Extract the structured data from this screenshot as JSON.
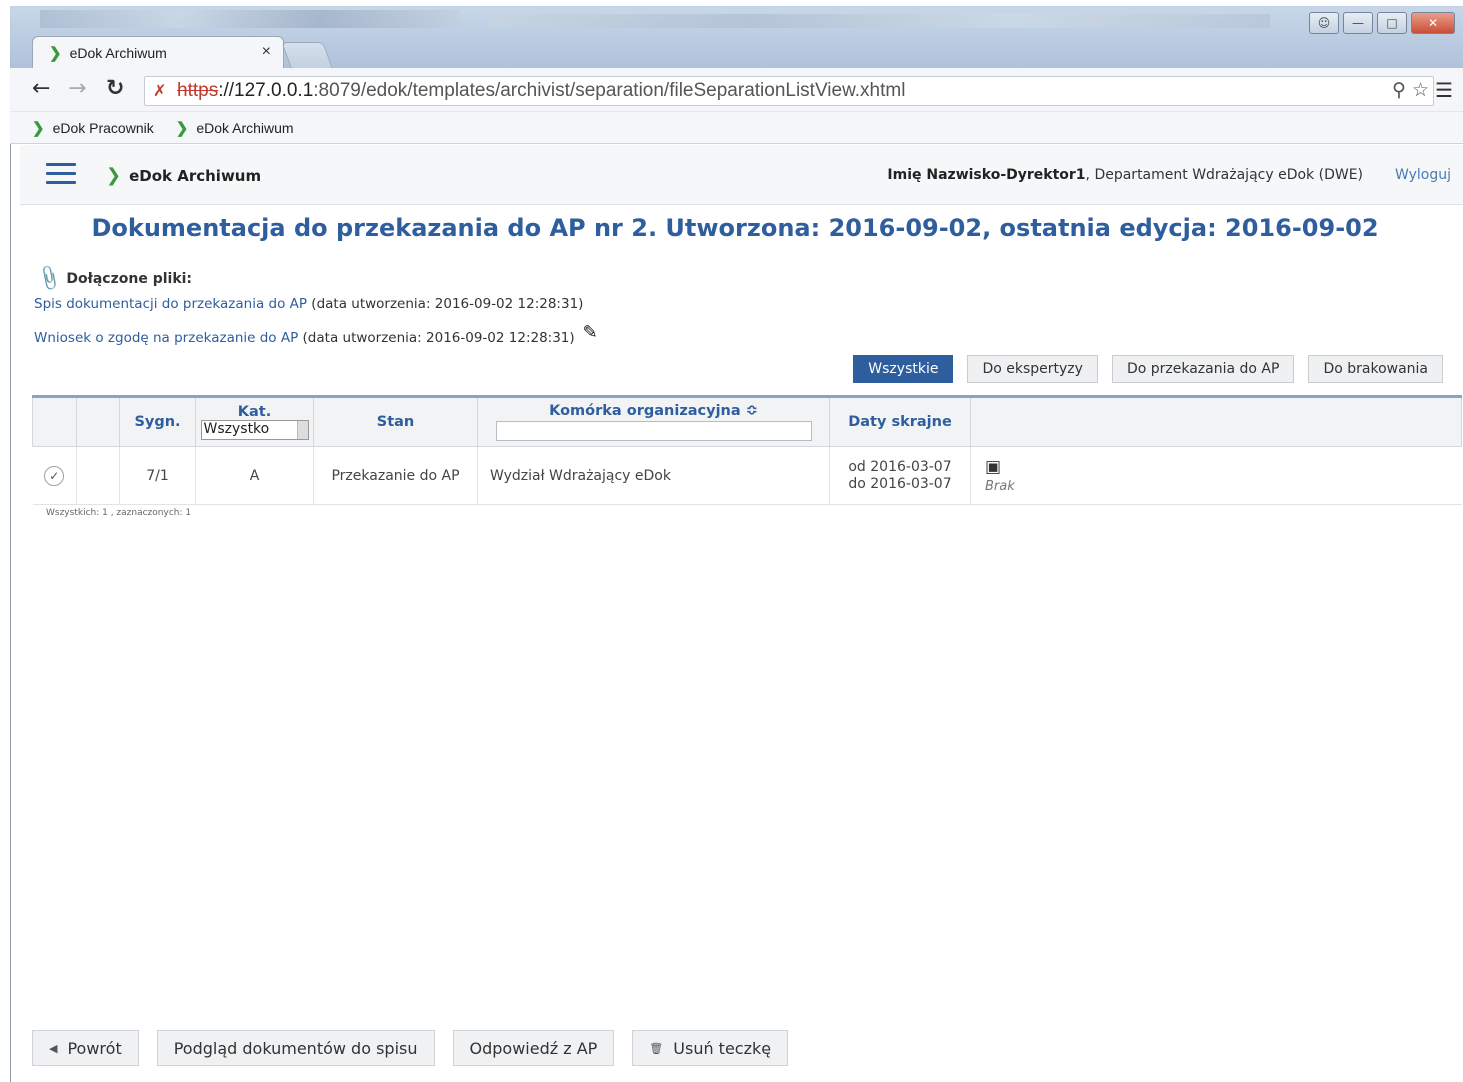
{
  "browser": {
    "tab_title": "eDok Archiwum",
    "tab_close": "×",
    "url_scheme": "https",
    "url_host": "://127.0.0.1",
    "url_rest": ":8079/edok/templates/archivist/separation/fileSeparationListView.xhtml",
    "bookmarks": [
      "eDok Pracownik",
      "eDok Archiwum"
    ],
    "icons": [
      "back-icon",
      "forward-icon",
      "reload-icon",
      "insecure-icon",
      "zoom-icon",
      "star-icon",
      "menu-icon"
    ]
  },
  "app": {
    "name": "eDok Archiwum",
    "user_name": "Imię Nazwisko-Dyrektor1",
    "user_dept": ", Departament Wdrażający eDok (DWE)",
    "logout": "Wyloguj"
  },
  "page": {
    "title": "Dokumentacja do przekazania do AP nr 2. Utworzona: 2016-09-02, ostatnia edycja: 2016-09-02",
    "attached_label": "Dołączone pliki:",
    "files": [
      {
        "link": "Spis dokumentacji do przekazania do AP",
        "meta": " (data utworzenia: 2016-09-02 12:28:31)"
      },
      {
        "link": "Wniosek o zgodę na przekazanie do AP",
        "meta": " (data utworzenia: 2016-09-02 12:28:31)"
      }
    ]
  },
  "filters": [
    "Wszystkie",
    "Do ekspertyzy",
    "Do przekazania do AP",
    "Do brakowania"
  ],
  "table": {
    "headers": {
      "sygn": "Sygn.",
      "kat": "Kat.",
      "kat_select": "Wszystko",
      "stan": "Stan",
      "komorka": "Komórka organizacyjna ≎",
      "daty": "Daty skrajne"
    },
    "rows": [
      {
        "sygn": "7/1",
        "kat": "A",
        "stan": "Przekazanie do AP",
        "komorka": "Wydział Wdrażający eDok",
        "od": "od 2016-03-07",
        "do": "do 2016-03-07",
        "status": "Brak"
      }
    ],
    "summary": "Wszystkich: 1 , zaznaczonych: 1"
  },
  "actions": [
    "Powrót",
    "Podgląd dokumentów do spisu",
    "Odpowiedź z AP",
    "Usuń teczkę"
  ],
  "colors": {
    "accent": "#2f5e9e",
    "chevron": "#3a9a3a"
  }
}
